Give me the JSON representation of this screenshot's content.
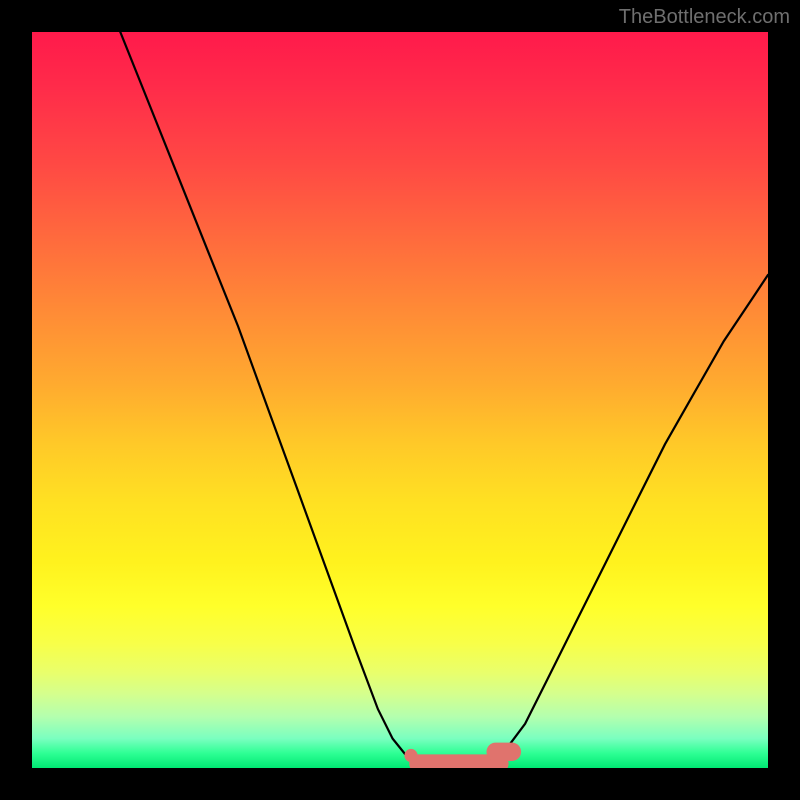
{
  "watermark": "TheBottleneck.com",
  "colors": {
    "black": "#000000",
    "curve_stroke": "#000000",
    "marker_fill": "#e0736d",
    "marker_stroke": "#d9665f",
    "gradient_top": "#ff1a4b",
    "gradient_bottom": "#00e873"
  },
  "chart_data": {
    "type": "line",
    "title": "",
    "xlabel": "",
    "ylabel": "",
    "xlim": [
      0,
      100
    ],
    "ylim": [
      0,
      100
    ],
    "grid": false,
    "legend": false,
    "series": [
      {
        "name": "left-curve",
        "x": [
          12,
          16,
          20,
          24,
          28,
          32,
          36,
          40,
          44,
          47,
          49,
          51,
          52
        ],
        "y": [
          100,
          90,
          80,
          70,
          60,
          49,
          38,
          27,
          16,
          8,
          4,
          1.5,
          0.5
        ]
      },
      {
        "name": "right-curve",
        "x": [
          62,
          64,
          67,
          70,
          74,
          78,
          82,
          86,
          90,
          94,
          98,
          100
        ],
        "y": [
          0.5,
          2,
          6,
          12,
          20,
          28,
          36,
          44,
          51,
          58,
          64,
          67
        ]
      },
      {
        "name": "flat-bottom",
        "x": [
          52,
          55,
          58,
          60,
          62
        ],
        "y": [
          0.5,
          0.3,
          0.3,
          0.3,
          0.5
        ]
      }
    ],
    "markers": [
      {
        "name": "dot-left",
        "shape": "circle",
        "cx": 51.5,
        "cy": 1.7,
        "r": 0.9
      },
      {
        "name": "bar-left",
        "shape": "rounded-blob",
        "x0": 52.5,
        "x1": 58.0,
        "y": 0.6,
        "thickness": 2.5
      },
      {
        "name": "bar-right",
        "shape": "rounded-blob",
        "x0": 58.0,
        "x1": 63.5,
        "y": 0.6,
        "thickness": 2.5
      },
      {
        "name": "tail-right",
        "shape": "rounded-blob",
        "x0": 63.0,
        "x1": 65.2,
        "y": 2.2,
        "thickness": 2.5
      }
    ],
    "note": "Axes are unlabeled in the source image; x and y are normalized 0–100 to the visible plot area. y=0 is the bottom edge, y=100 is the top edge."
  }
}
